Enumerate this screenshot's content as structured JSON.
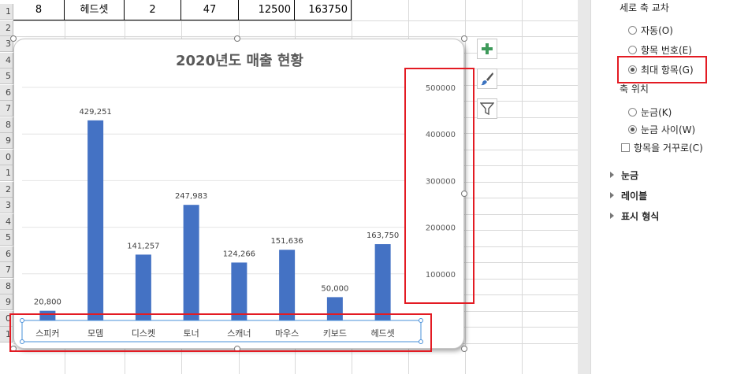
{
  "sheet": {
    "row_numbers": [
      "1",
      "2",
      "3",
      "4",
      "5",
      "6",
      "7",
      "8",
      "9",
      "0",
      "1",
      "2",
      "3",
      "4",
      "5",
      "6",
      "7",
      "8",
      "9",
      "0",
      "1"
    ],
    "top_row": [
      "8",
      "헤드셋",
      "2",
      "47",
      "12500",
      "163750"
    ]
  },
  "chart": {
    "title": "2020년도 매출 현황",
    "chart_data": {
      "type": "bar",
      "title": "2020년도 매출 현황",
      "categories": [
        "스피커",
        "모뎀",
        "디스켓",
        "토너",
        "스캐너",
        "마우스",
        "키보드",
        "헤드셋"
      ],
      "values": [
        20800,
        429251,
        141257,
        247983,
        124266,
        151636,
        50000,
        163750
      ],
      "data_labels": [
        "20,800",
        "429,251",
        "141,257",
        "247,983",
        "124,266",
        "151,636",
        "50,000",
        "163,750"
      ],
      "y_ticks": [
        "100000",
        "200000",
        "300000",
        "400000",
        "500000"
      ],
      "ylim": [
        0,
        500000
      ],
      "y_axis_position": "right",
      "grid": true,
      "bar_color": "#4472c4"
    }
  },
  "side_buttons": [
    "plus-icon",
    "brush-icon",
    "filter-icon"
  ],
  "pane": {
    "cross_title": "세로 축 교차",
    "cross_options": [
      {
        "label": "자동(O)",
        "selected": false
      },
      {
        "label": "항목 번호(E)",
        "selected": false
      },
      {
        "label": "최대 항목(G)",
        "selected": true
      }
    ],
    "axis_pos_title": "축 위치",
    "axis_pos_options": [
      {
        "label": "눈금(K)",
        "selected": false
      },
      {
        "label": "눈금 사이(W)",
        "selected": true
      }
    ],
    "reverse_label": "항목을 거꾸로(C)",
    "sections": [
      "눈금",
      "레이블",
      "표시 형식"
    ]
  },
  "colors": {
    "highlight": "#e31b23",
    "bar": "#4472c4"
  }
}
